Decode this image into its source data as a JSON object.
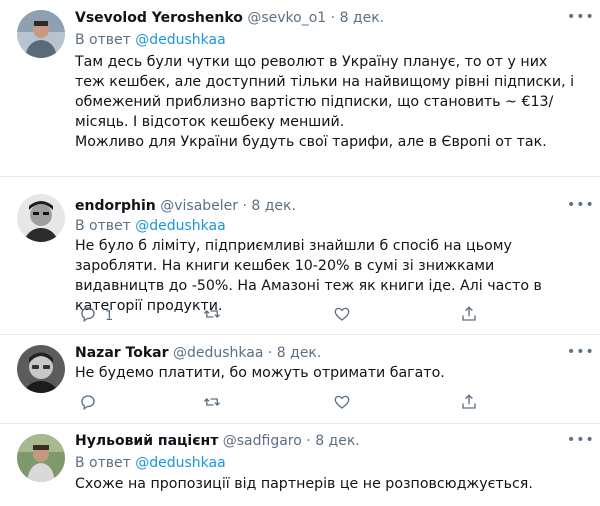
{
  "tweets": [
    {
      "author_name": "Vsevolod Yeroshenko",
      "handle": "@sevko_o1",
      "separator": "·",
      "date": "8 дек.",
      "reply_prefix": "В ответ",
      "reply_to": "@dedushkaa",
      "paragraphs": [
        "Там десь були чутки що револют в Україну планує, то от у них теж кешбек, але доступний тільки на найвищому рівні підписки, і обмежений приблизно вартістю підписки, що становить ~ €13/місяць. І відсоток кешбеку менший.",
        "Можливо для України будуть свої тарифи, але в Європі от так."
      ],
      "more_icon": "more-dots-icon"
    },
    {
      "author_name": "endorphin",
      "handle": "@visabeler",
      "separator": "·",
      "date": "8 дек.",
      "reply_prefix": "В ответ",
      "reply_to": "@dedushkaa",
      "paragraphs": [
        "Не було б ліміту, підприємливі знайшли б спосіб на цьому заробляти. На книги кешбек 10-20% в сумі зі знижками видавництв до -50%. На Амазоні теж як книги іде. Алі часто в категорії продукти."
      ],
      "actions": {
        "reply_count": "1"
      },
      "more_icon": "more-dots-icon"
    },
    {
      "author_name": "Nazar Tokar",
      "handle": "@dedushkaa",
      "separator": "·",
      "date": "8 дек.",
      "paragraphs": [
        "Не будемо платити, бо можуть отримати багато."
      ],
      "more_icon": "more-dots-icon"
    },
    {
      "author_name": "Нульовий пацієнт",
      "handle": "@sadfigaro",
      "separator": "·",
      "date": "8 дек.",
      "reply_prefix": "В ответ",
      "reply_to": "@dedushkaa",
      "paragraphs": [
        "Схоже на пропозиції від партнерів це не розповсюджується."
      ],
      "more_icon": "more-dots-icon"
    }
  ],
  "action_icons": [
    "reply-icon",
    "retweet-icon",
    "like-icon",
    "share-icon"
  ],
  "colors": {
    "link": "#1b95e0",
    "muted": "#5b7083",
    "text": "#0f1419",
    "divider": "#e6ecf0"
  }
}
